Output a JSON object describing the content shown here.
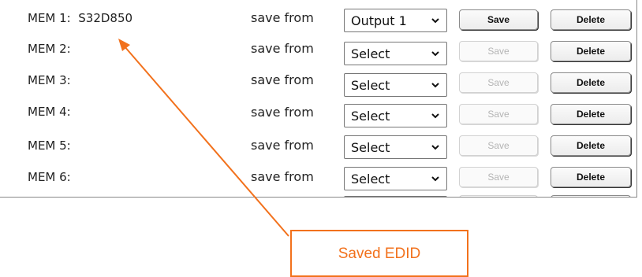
{
  "memory_slots": [
    {
      "label": "MEM 1:  S32D850",
      "save_from_label": "save from",
      "source": "Output 1",
      "save_label": "Save",
      "save_enabled": true,
      "delete_label": "Delete"
    },
    {
      "label": "MEM 2:",
      "save_from_label": "save from",
      "source": "Select",
      "save_label": "Save",
      "save_enabled": false,
      "delete_label": "Delete"
    },
    {
      "label": "MEM 3:",
      "save_from_label": "save from",
      "source": "Select",
      "save_label": "Save",
      "save_enabled": false,
      "delete_label": "Delete"
    },
    {
      "label": "MEM 4:",
      "save_from_label": "save from",
      "source": "Select",
      "save_label": "Save",
      "save_enabled": false,
      "delete_label": "Delete"
    },
    {
      "label": "MEM 5:",
      "save_from_label": "save from",
      "source": "Select",
      "save_label": "Save",
      "save_enabled": false,
      "delete_label": "Delete"
    },
    {
      "label": "MEM 6:",
      "save_from_label": "save from",
      "source": "Select",
      "save_label": "Save",
      "save_enabled": false,
      "delete_label": "Delete"
    }
  ],
  "annotation": {
    "text": "Saved EDID",
    "color": "#f2711c"
  },
  "icons": {
    "dropdown": "chevron-down-icon"
  }
}
